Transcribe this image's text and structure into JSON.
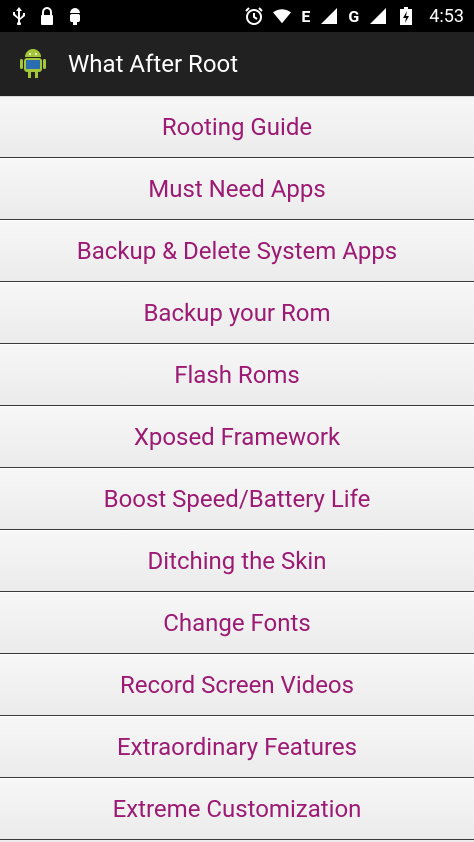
{
  "status_bar": {
    "time": "4:53",
    "network_label": "E",
    "signal_label": "G",
    "icons_left": [
      "usb-icon",
      "lock-icon",
      "android-debug-icon"
    ],
    "icons_right": [
      "alarm-icon",
      "wifi-icon",
      "signal-icon",
      "signal-icon",
      "battery-charging-icon"
    ]
  },
  "action_bar": {
    "title": "What After Root",
    "icon": "android-app-icon"
  },
  "menu": {
    "items": [
      {
        "label": "Rooting Guide"
      },
      {
        "label": "Must Need Apps"
      },
      {
        "label": "Backup & Delete System Apps"
      },
      {
        "label": "Backup your Rom"
      },
      {
        "label": "Flash Roms"
      },
      {
        "label": "Xposed Framework"
      },
      {
        "label": "Boost Speed/Battery Life"
      },
      {
        "label": "Ditching the Skin"
      },
      {
        "label": "Change Fonts"
      },
      {
        "label": "Record Screen Videos"
      },
      {
        "label": "Extraordinary Features"
      },
      {
        "label": "Extreme Customization"
      }
    ]
  },
  "colors": {
    "item_text": "#9c1a73",
    "action_bar_bg": "#212121",
    "status_bar_bg": "#000000"
  }
}
